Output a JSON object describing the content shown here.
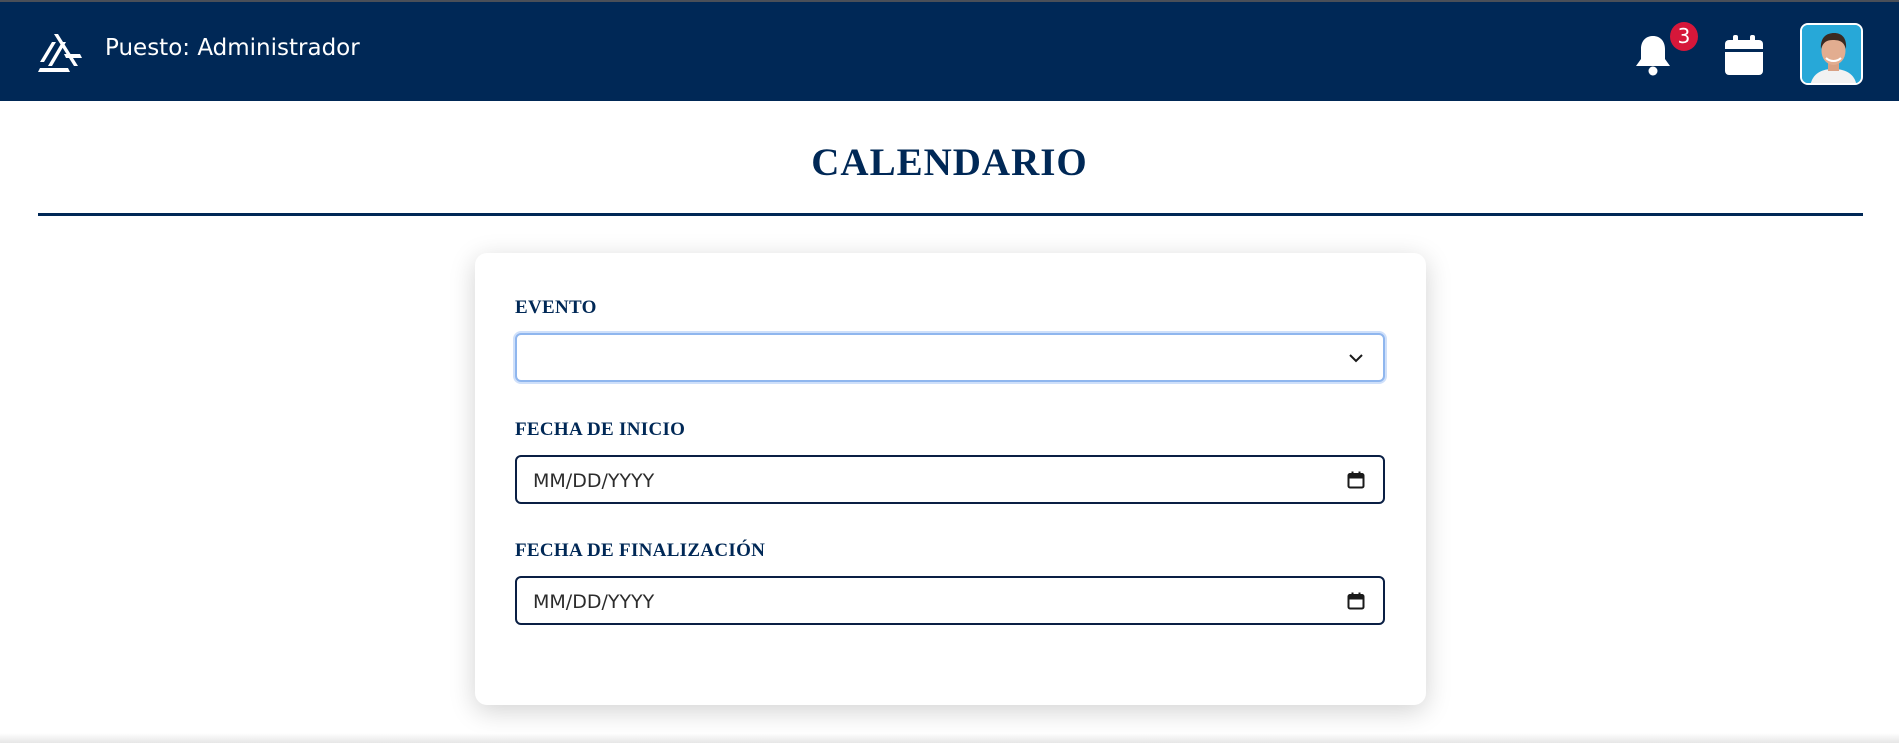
{
  "header": {
    "role_text": "Puesto: Administrador",
    "notifications_count": "3",
    "icons": [
      "logo-icon",
      "bell-icon",
      "calendar-icon",
      "user-avatar"
    ],
    "colors": {
      "bar": "#002856",
      "badge": "#d6173a"
    }
  },
  "page": {
    "title": "CALENDARIO"
  },
  "form": {
    "event_label": "EVENTO",
    "event_value": "",
    "start_label": "FECHA DE INICIO",
    "start_placeholder": "MM/DD/YYYY",
    "end_label": "FECHA DE FINALIZACIÓN",
    "end_placeholder": "MM/DD/YYYY"
  }
}
